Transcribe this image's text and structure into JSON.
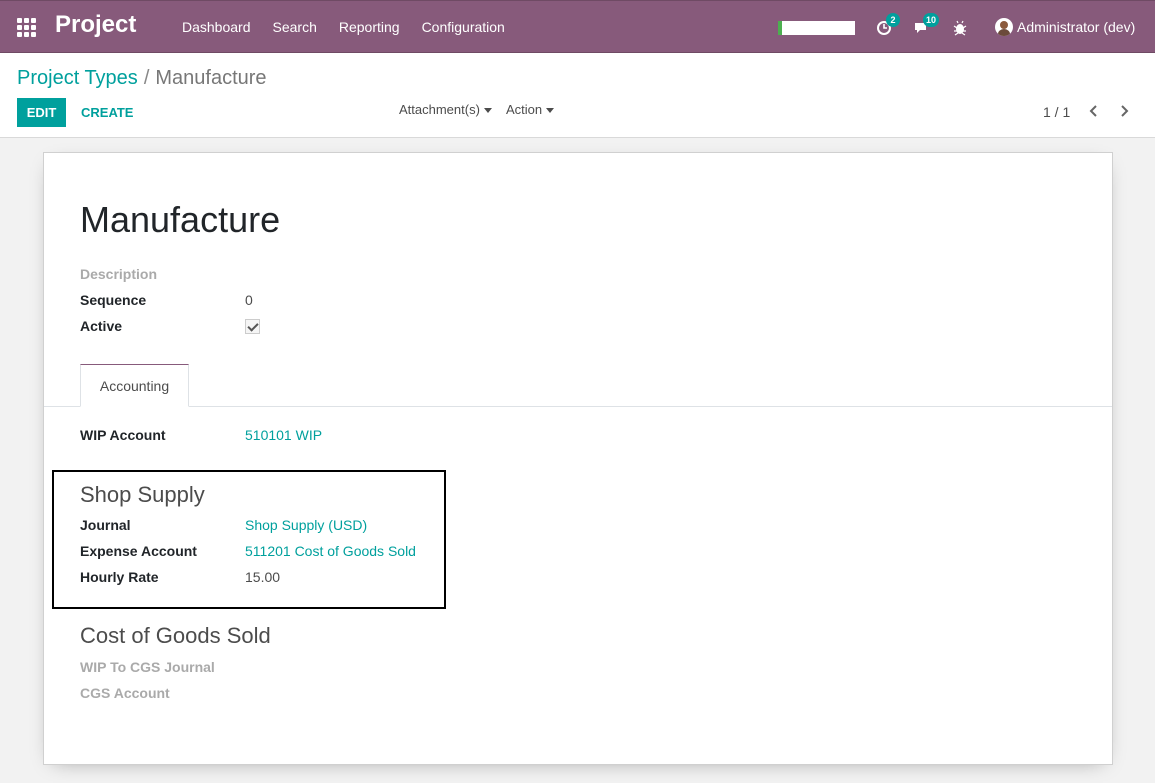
{
  "navbar": {
    "brand": "Project",
    "menu": [
      "Dashboard",
      "Search",
      "Reporting",
      "Configuration"
    ],
    "activity_count": "2",
    "messages_count": "10",
    "user": "Administrator (dev)",
    "colors": {
      "bar": "#875a7b",
      "badge": "#00a09d"
    }
  },
  "breadcrumb": {
    "parent": "Project Types",
    "separator": "/",
    "current": "Manufacture"
  },
  "buttons": {
    "edit": "EDIT",
    "create": "CREATE"
  },
  "sidebar": {
    "attachments": "Attachment(s)",
    "action": "Action"
  },
  "pager": {
    "value": "1 / 1"
  },
  "form": {
    "title": "Manufacture",
    "description_label": "Description",
    "sequence_label": "Sequence",
    "sequence_value": "0",
    "active_label": "Active",
    "active_checked": true,
    "tab": "Accounting",
    "wip_account_label": "WIP Account",
    "wip_account_value": "510101 WIP",
    "shop_supply": {
      "title": "Shop Supply",
      "journal_label": "Journal",
      "journal_value": "Shop Supply (USD)",
      "expense_label": "Expense Account",
      "expense_value": "511201 Cost of Goods Sold",
      "hourly_label": "Hourly Rate",
      "hourly_value": "15.00"
    },
    "cogs": {
      "title": "Cost of Goods Sold",
      "wip_journal_label": "WIP To CGS Journal",
      "cgs_account_label": "CGS Account"
    }
  }
}
